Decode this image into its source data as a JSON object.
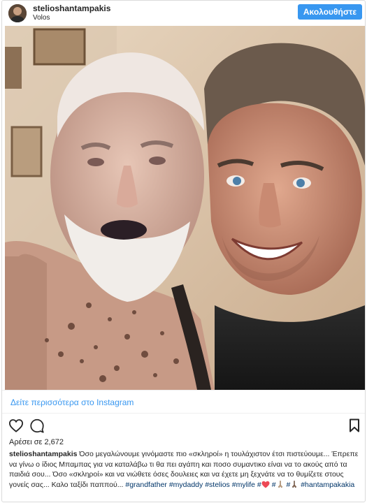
{
  "header": {
    "username": "stelioshantampakis",
    "location": "Volos",
    "follow_label": "Ακολουθήστε"
  },
  "photo": {
    "alt": "Selfie of a young man with his elderly grandfather"
  },
  "more_link": "Δείτε περισσότερα στο Instagram",
  "actions": {
    "icons": [
      "heart-icon",
      "comment-icon",
      "bookmark-icon"
    ]
  },
  "likes": "Αρέσει σε 2,672",
  "caption": {
    "username": "stelioshantampakis",
    "text": " Όσο μεγαλώνουμε γινόμαστε πιο «σκληροί» η τουλάχιστον έτσι πιστεύουμε... Έπρεπε να γίνω ο ίδιος Μπαμπας για να καταλάβω τι θα πει αγάπη και ποσο συμαντικο είναι να το ακούς από τα παιδιά σου... Όσο «σκληροί» και να νιώθετε όσες δουλειες και να έχετε μη ξεχνάτε να το θυμίζετε στους γονείς σας... Καλο ταξίδι παππού... ",
    "hashtags": [
      "#grandfather",
      "#mydaddy",
      "#stelios",
      "#mylife",
      "#",
      "#",
      "#",
      "#hantampakakia"
    ],
    "emoji_names": [
      "red-heart-emoji",
      "praying-hands-emoji",
      "praying-hands-emoji"
    ]
  },
  "colors": {
    "follow_button": "#3897f0",
    "link": "#3897f0",
    "hashtag": "#003569",
    "heart": "#ed4956"
  }
}
